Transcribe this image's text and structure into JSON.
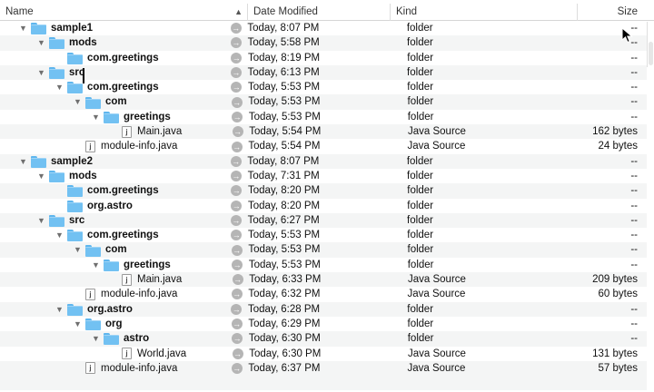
{
  "header": {
    "name": "Name",
    "date_modified": "Date Modified",
    "kind": "Kind",
    "size": "Size"
  },
  "rows": [
    {
      "name": "sample1",
      "depth": 0,
      "type": "folder",
      "expanded": true,
      "date": "Today, 8:07 PM",
      "kind": "folder",
      "size": "--"
    },
    {
      "name": "mods",
      "depth": 1,
      "type": "folder",
      "expanded": true,
      "date": "Today, 5:58 PM",
      "kind": "folder",
      "size": "--"
    },
    {
      "name": "com.greetings",
      "depth": 2,
      "type": "folder",
      "expanded": false,
      "date": "Today, 8:19 PM",
      "kind": "folder",
      "size": "--"
    },
    {
      "name": "src",
      "depth": 1,
      "type": "folder",
      "expanded": true,
      "date": "Today, 6:13 PM",
      "kind": "folder",
      "size": "--"
    },
    {
      "name": "com.greetings",
      "depth": 2,
      "type": "folder",
      "expanded": true,
      "date": "Today, 5:53 PM",
      "kind": "folder",
      "size": "--"
    },
    {
      "name": "com",
      "depth": 3,
      "type": "folder",
      "expanded": true,
      "date": "Today, 5:53 PM",
      "kind": "folder",
      "size": "--"
    },
    {
      "name": "greetings",
      "depth": 4,
      "type": "folder",
      "expanded": true,
      "date": "Today, 5:53 PM",
      "kind": "folder",
      "size": "--"
    },
    {
      "name": "Main.java",
      "depth": 5,
      "type": "java",
      "date": "Today, 5:54 PM",
      "kind": "Java Source",
      "size": "162 bytes"
    },
    {
      "name": "module-info.java",
      "depth": 3,
      "type": "java",
      "date": "Today, 5:54 PM",
      "kind": "Java Source",
      "size": "24 bytes"
    },
    {
      "name": "sample2",
      "depth": 0,
      "type": "folder",
      "expanded": true,
      "date": "Today, 8:07 PM",
      "kind": "folder",
      "size": "--"
    },
    {
      "name": "mods",
      "depth": 1,
      "type": "folder",
      "expanded": true,
      "date": "Today, 7:31 PM",
      "kind": "folder",
      "size": "--"
    },
    {
      "name": "com.greetings",
      "depth": 2,
      "type": "folder",
      "expanded": false,
      "date": "Today, 8:20 PM",
      "kind": "folder",
      "size": "--"
    },
    {
      "name": "org.astro",
      "depth": 2,
      "type": "folder",
      "expanded": false,
      "date": "Today, 8:20 PM",
      "kind": "folder",
      "size": "--"
    },
    {
      "name": "src",
      "depth": 1,
      "type": "folder",
      "expanded": true,
      "date": "Today, 6:27 PM",
      "kind": "folder",
      "size": "--"
    },
    {
      "name": "com.greetings",
      "depth": 2,
      "type": "folder",
      "expanded": true,
      "date": "Today, 5:53 PM",
      "kind": "folder",
      "size": "--"
    },
    {
      "name": "com",
      "depth": 3,
      "type": "folder",
      "expanded": true,
      "date": "Today, 5:53 PM",
      "kind": "folder",
      "size": "--"
    },
    {
      "name": "greetings",
      "depth": 4,
      "type": "folder",
      "expanded": true,
      "date": "Today, 5:53 PM",
      "kind": "folder",
      "size": "--"
    },
    {
      "name": "Main.java",
      "depth": 5,
      "type": "java",
      "date": "Today, 6:33 PM",
      "kind": "Java Source",
      "size": "209 bytes"
    },
    {
      "name": "module-info.java",
      "depth": 3,
      "type": "java",
      "date": "Today, 6:32 PM",
      "kind": "Java Source",
      "size": "60 bytes"
    },
    {
      "name": "org.astro",
      "depth": 2,
      "type": "folder",
      "expanded": true,
      "date": "Today, 6:28 PM",
      "kind": "folder",
      "size": "--"
    },
    {
      "name": "org",
      "depth": 3,
      "type": "folder",
      "expanded": true,
      "date": "Today, 6:29 PM",
      "kind": "folder",
      "size": "--"
    },
    {
      "name": "astro",
      "depth": 4,
      "type": "folder",
      "expanded": true,
      "date": "Today, 6:30 PM",
      "kind": "folder",
      "size": "--"
    },
    {
      "name": "World.java",
      "depth": 5,
      "type": "java",
      "date": "Today, 6:30 PM",
      "kind": "Java Source",
      "size": "131 bytes"
    },
    {
      "name": "module-info.java",
      "depth": 3,
      "type": "java",
      "date": "Today, 6:37 PM",
      "kind": "Java Source",
      "size": "57 bytes"
    }
  ]
}
